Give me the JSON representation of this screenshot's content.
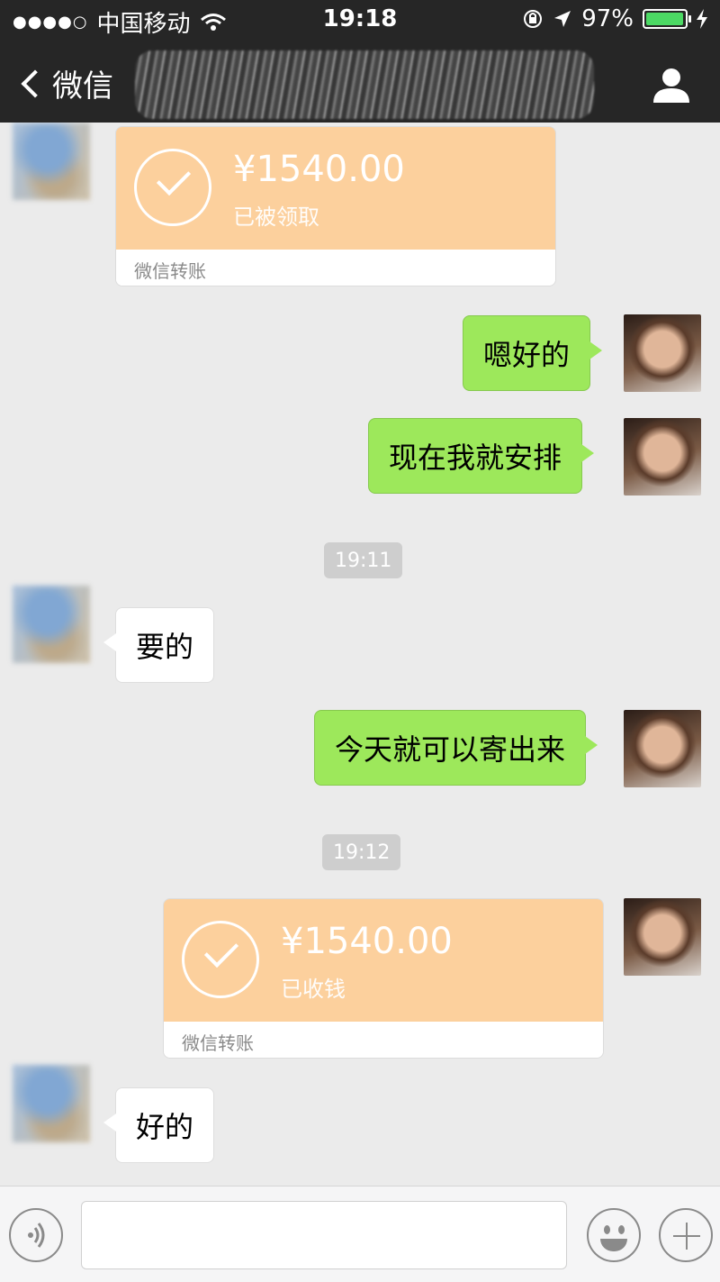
{
  "status_bar": {
    "signal": "●●●●○",
    "carrier": "中国移动",
    "time": "19:18",
    "battery": "97%",
    "battery_level": 0.97
  },
  "nav": {
    "back_label": "微信"
  },
  "messages": {
    "m1_amount": "¥1540.00",
    "m1_status": "已被领取",
    "m1_footer": "微信转账",
    "m2_text": "嗯好的",
    "m3_text": "现在我就安排",
    "time1": "19:11",
    "m4_text": "要的",
    "m5_text": "今天就可以寄出来",
    "time2": "19:12",
    "m6_amount": "¥1540.00",
    "m6_status": "已收钱",
    "m6_footer": "微信转账",
    "m7_text": "好的"
  },
  "colors": {
    "topbar": "#262626",
    "outgoing_bubble": "#9de85b",
    "incoming_bubble": "#ffffff",
    "transfer": "#fcd09d",
    "battery_fill": "#4cd964"
  }
}
